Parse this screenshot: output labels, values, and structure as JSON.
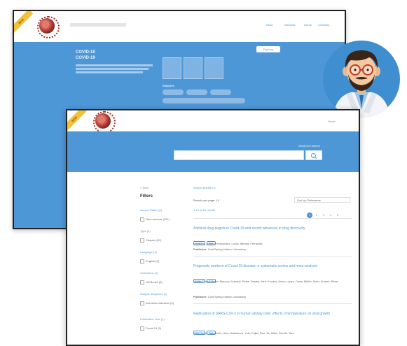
{
  "back_window": {
    "ribbon": "NEW",
    "nav": [
      "Inicio",
      "Artículos",
      "Libros",
      "Contacto"
    ],
    "hero_title_line1": "COVID-19",
    "hero_title_line2": "COVID-19",
    "button": "Explorar",
    "subjects_label": "Subjects"
  },
  "front_window": {
    "ribbon": "NEW",
    "header_link": "Home",
    "search_caption": "Advanced search",
    "filters": {
      "back_link": "< Back",
      "title": "Filters",
      "groups": [
        {
          "head": "Access Status (1)",
          "item": "Open access (221)"
        },
        {
          "head": "Type (1)",
          "item": "Chapter (51)"
        },
        {
          "head": "Language (1)",
          "item": "English (3)"
        },
        {
          "head": "Collections (1)",
          "item": "SN Books (5)"
        },
        {
          "head": "Subject Sequence (1)",
          "item": "Infectious diseases (3)"
        },
        {
          "head": "Publication Year (1)",
          "item": "Covid-19 (5)"
        }
      ]
    },
    "results_header": "Search results (1)",
    "pagination_label": "Results per page: 10",
    "results_count": "1-10 of 20 results",
    "sort_label": "Sort by: Relevance",
    "pages": [
      "1",
      "2",
      "3",
      "4",
      "5"
    ],
    "results": [
      {
        "title": "Antiviral drug targets in Covid-19 and recent advances in drug discovery",
        "tags": [
          "Chapter",
          "Book"
        ],
        "authors": "Marques, Juliana; Hernández, Lucía; Bemba, Fernanda",
        "publisher_label": "Publisher:",
        "publisher": "Cold Spring Harbor Laboratory"
      },
      {
        "title": "Prognostic markers of Covid-19 disease: a systematic review and meta-analysis",
        "tags": [
          "Chapter",
          "Book"
        ],
        "authors": "Moritz, Franz; Keller, Marcus; Schmidt, Petra; Tanaka, Hiro; Kovacs, Anna; Lopez, Carla; Müller, Sven; Ahmed, Rima",
        "publisher_label": "Publisher:",
        "publisher": "Cold Spring Harbor Laboratory"
      },
      {
        "title": "Replication of SARS-CoV-2 in human airway cells: effects of temperature on viral growth",
        "tags": [
          "Chapter",
          "Book"
        ],
        "authors": "Sato, Kenji; Yamamoto, Aiko; Nakamura, Yuki; Fujita, Ren; Ito, Mika; Suzuki, Taro"
      }
    ]
  },
  "colors": {
    "primary": "#4e97d6",
    "ribbon": "#f3c23a",
    "doctor_background": "#3f8fd0"
  },
  "icons": {
    "logo": "coronavirus-logo-icon",
    "search": "search-icon",
    "avatar": "doctor-avatar-icon"
  }
}
